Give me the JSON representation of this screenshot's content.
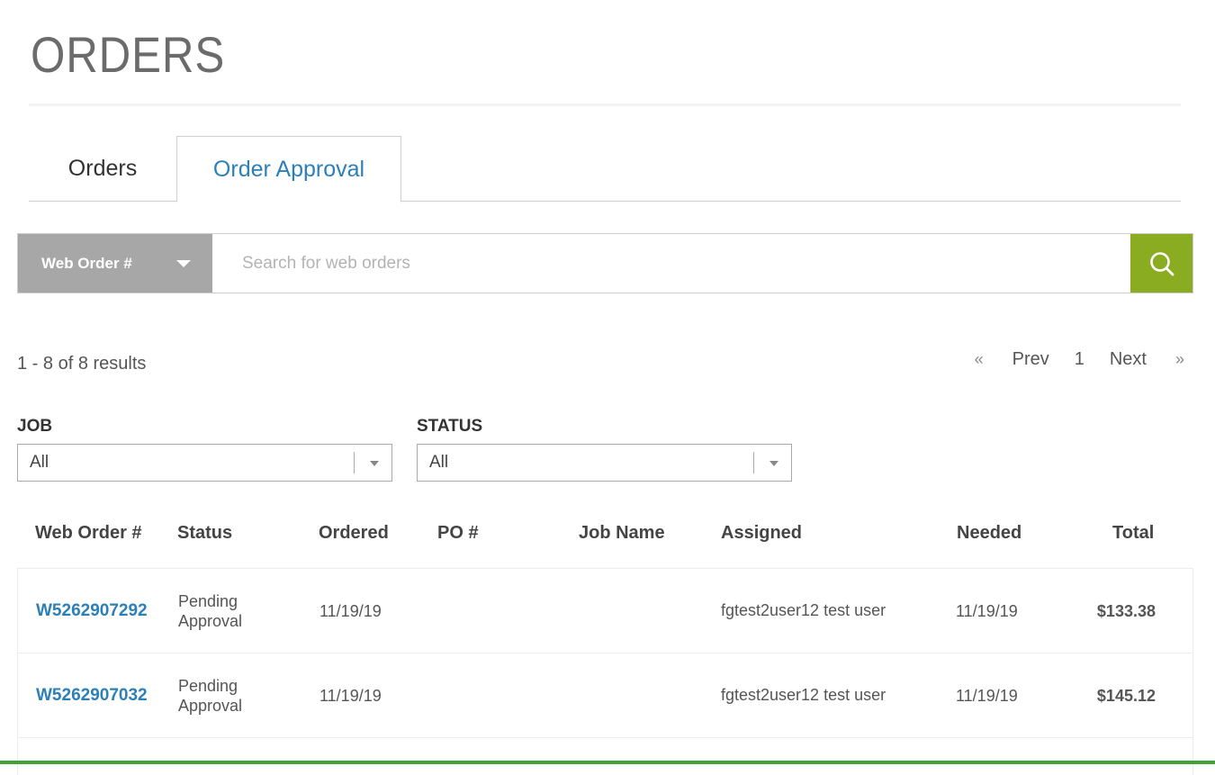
{
  "page": {
    "title": "ORDERS"
  },
  "tabs": [
    {
      "label": "Orders",
      "active": false
    },
    {
      "label": "Order Approval",
      "active": true
    }
  ],
  "search": {
    "type_label": "Web Order #",
    "placeholder": "Search for web orders",
    "button_icon": "search-icon",
    "button_color": "#8aac21"
  },
  "results": {
    "summary": "1 - 8 of 8 results"
  },
  "pagination": {
    "first": "«",
    "prev": "Prev",
    "current": "1",
    "next": "Next",
    "last": "»"
  },
  "filters": {
    "job": {
      "label": "JOB",
      "value": "All"
    },
    "status": {
      "label": "STATUS",
      "value": "All"
    }
  },
  "table": {
    "columns": [
      "Web Order #",
      "Status",
      "Ordered",
      "PO #",
      "Job Name",
      "Assigned",
      "Needed",
      "Total"
    ],
    "rows": [
      {
        "order": "W5262907292",
        "status_line1": "Pending",
        "status_line2": "Approval",
        "ordered": "11/19/19",
        "po": "",
        "job_name": "",
        "assigned": "fgtest2user12 test user",
        "needed": "11/19/19",
        "total": "$133.38"
      },
      {
        "order": "W5262907032",
        "status_line1": "Pending",
        "status_line2": "Approval",
        "ordered": "11/19/19",
        "po": "",
        "job_name": "",
        "assigned": "fgtest2user12 test user",
        "needed": "11/19/19",
        "total": "$145.12"
      }
    ]
  },
  "colors": {
    "link": "#2b80b9",
    "accent_green": "#8aac21",
    "search_type_bg": "#a7a7a7"
  }
}
